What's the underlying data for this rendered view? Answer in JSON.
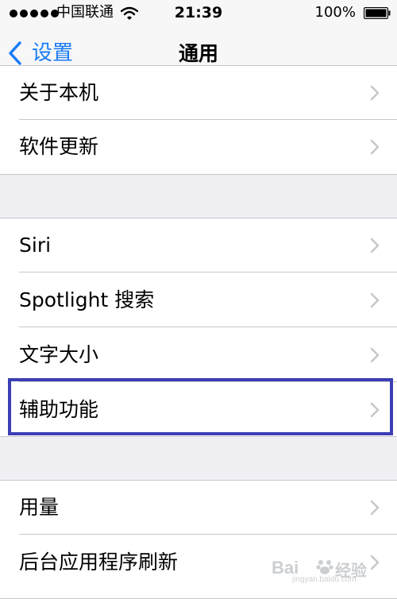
{
  "status_bar": {
    "carrier": "中国联通",
    "time": "21:39",
    "battery_percent": "100%",
    "battery_level": 1.0,
    "signal_bars": 5
  },
  "nav": {
    "back_label": "设置",
    "title": "通用"
  },
  "groups": [
    {
      "items": [
        {
          "label": "关于本机"
        },
        {
          "label": "软件更新"
        }
      ]
    },
    {
      "items": [
        {
          "label": "Siri"
        },
        {
          "label": "Spotlight 搜索"
        },
        {
          "label": "文字大小"
        },
        {
          "label": "辅助功能",
          "highlighted": true
        }
      ]
    },
    {
      "items": [
        {
          "label": "用量"
        },
        {
          "label": "后台应用程序刷新"
        }
      ]
    }
  ],
  "watermark": {
    "brand": "Bai",
    "suffix": "经验",
    "url": "jingyan.baidu.com"
  },
  "colors": {
    "accent": "#1a7cf5",
    "highlight_border": "#3b3fb4",
    "background": "#efeff4"
  }
}
